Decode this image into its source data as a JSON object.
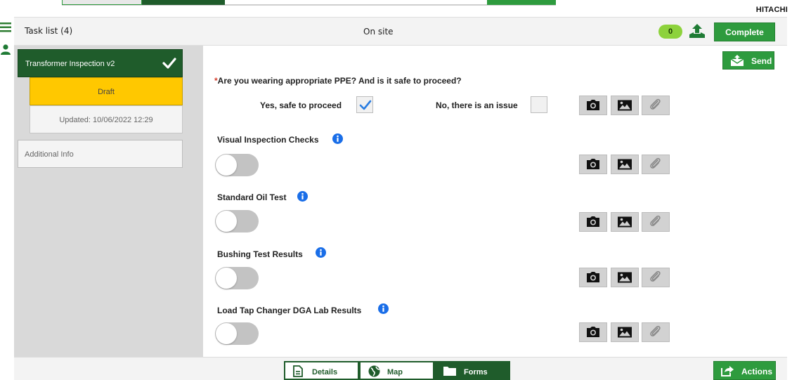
{
  "brand": {
    "name": "HITACHI"
  },
  "colors": {
    "primary_green": "#2e9b3e",
    "dark_green": "#1f5c2b",
    "draft_yellow": "#ffc800",
    "badge_green": "#8dd23c",
    "required_red": "#d43b2b",
    "info_blue": "#1a6ee8"
  },
  "header": {
    "task_list_label": "Task list (4)",
    "status_text": "On site",
    "badge_count": "0",
    "upload_icon": "cloud-upload-icon",
    "complete_label": "Complete"
  },
  "sidebar": {
    "task": {
      "title": "Transformer Inspection v2",
      "icon": "checkmark-icon"
    },
    "draft_label": "Draft",
    "updated_text": "Updated: 10/06/2022 12:29",
    "additional_info_label": "Additional Info"
  },
  "main": {
    "send_label": "Send",
    "questions": [
      {
        "required_mark": "*",
        "label": "Are you wearing appropriate PPE? And is it safe to proceed?",
        "options": [
          {
            "label": "Yes, safe to proceed",
            "checked": true
          },
          {
            "label": "No, there is an issue",
            "checked": false
          }
        ]
      },
      {
        "label": "Visual Inspection Checks",
        "has_info": true,
        "toggle_on": false
      },
      {
        "label": "Standard Oil Test",
        "has_info": true,
        "toggle_on": false
      },
      {
        "label": "Bushing Test Results",
        "has_info": true,
        "toggle_on": false
      },
      {
        "label": "Load Tap Changer DGA Lab Results",
        "has_info": true,
        "toggle_on": false
      }
    ],
    "media_icons": [
      "camera-icon",
      "image-icon",
      "paperclip-icon"
    ]
  },
  "bottom": {
    "tabs": [
      {
        "label": "Details",
        "icon": "document-icon",
        "active": false
      },
      {
        "label": "Map",
        "icon": "globe-icon",
        "active": false
      },
      {
        "label": "Forms",
        "icon": "folder-icon",
        "active": true
      }
    ],
    "actions_label": "Actions"
  }
}
